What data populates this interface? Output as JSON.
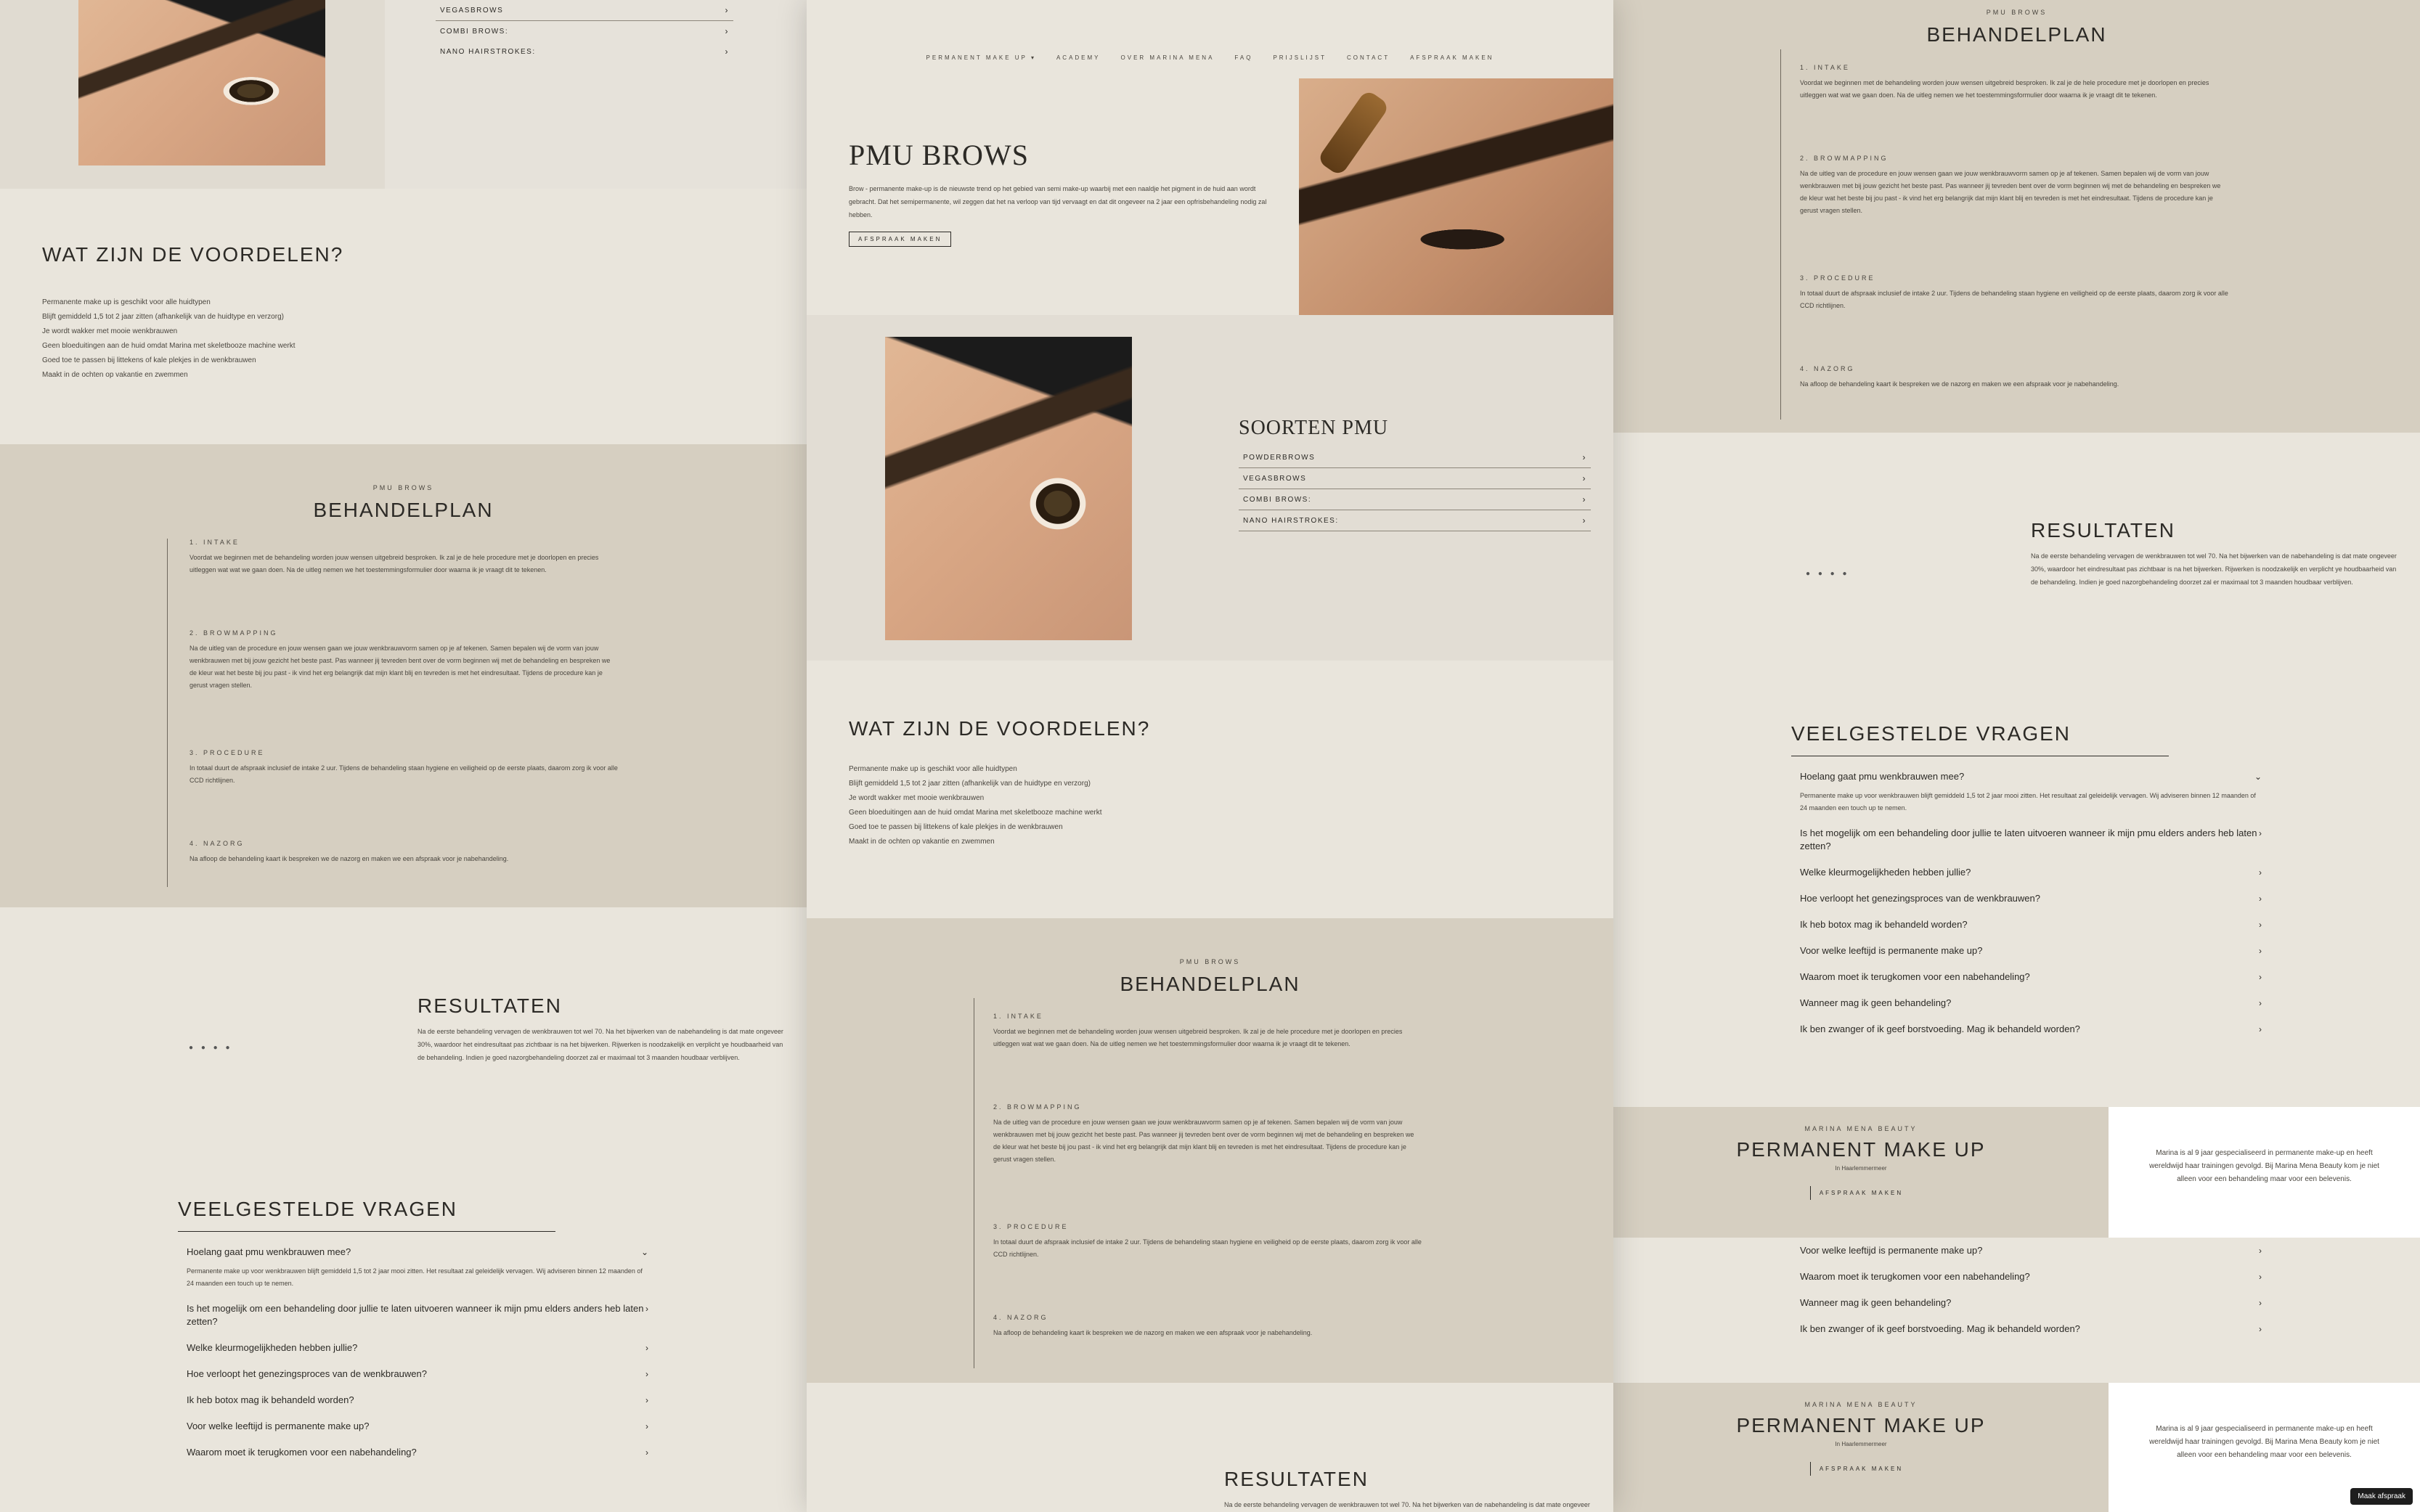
{
  "nav": {
    "items": [
      "PERMANENT MAKE UP ▾",
      "ACADEMY",
      "OVER MARINA MENA",
      "FAQ",
      "PRIJSLIJST",
      "CONTACT",
      "AFSPRAAK MAKEN"
    ]
  },
  "hero": {
    "title": "PMU BROWS",
    "body": "Brow - permanente make-up is de nieuwste trend op het gebied van semi make-up waarbij met een naaldje het pigment in de huid aan wordt gebracht. Dat het semipermanente, wil zeggen dat het na verloop van tijd vervaagt en dat dit ongeveer na 2 jaar een opfrisbehandeling nodig zal hebben.",
    "button": "AFSPRAAK MAKEN"
  },
  "soorten": {
    "title": "SOORTEN PMU",
    "items": [
      "POWDERBROWS",
      "VEGASBROWS",
      "COMBI BROWS:",
      "NANO HAIRSTROKES:"
    ]
  },
  "voordelen": {
    "title": "WAT ZIJN DE VOORDELEN?",
    "items": [
      "Permanente make up is geschikt voor alle huidtypen",
      "Blijft gemiddeld 1,5 tot 2 jaar zitten (afhankelijk van de huidtype en verzorg)",
      "Je wordt wakker met mooie wenkbrauwen",
      "Geen bloeduitingen aan de huid omdat Marina met skeletbooze machine werkt",
      "Goed toe te passen bij littekens of kale plekjes in de wenkbrauwen",
      "Maakt in de ochten op vakantie en zwemmen"
    ]
  },
  "behandelplan": {
    "kicker": "PMU BROWS",
    "title": "BEHANDELPLAN",
    "steps": [
      {
        "title": "1. INTAKE",
        "text": "Voordat we beginnen met de behandeling worden jouw wensen uitgebreid besproken. Ik zal je de hele procedure met je doorlopen en precies uitleggen wat wat we gaan doen. Na de uitleg nemen we het toestemmingsformulier door waarna ik je vraagt dit te tekenen."
      },
      {
        "title": "2. BROWMAPPING",
        "text": "Na de uitleg van de procedure en jouw wensen gaan we jouw wenkbrauwvorm samen op je af tekenen. Samen bepalen wij de vorm van jouw wenkbrauwen met bij jouw gezicht het beste past. Pas wanneer jij tevreden bent over de vorm beginnen wij met de behandeling en bespreken we de kleur wat het beste bij jou past - ik vind het erg belangrijk dat mijn klant blij en tevreden is met het eindresultaat. Tijdens de procedure kan je gerust vragen stellen."
      },
      {
        "title": "3. PROCEDURE",
        "text": "In totaal duurt de afspraak inclusief de intake 2 uur. Tijdens de behandeling staan hygiene en veiligheid op de eerste plaats, daarom zorg ik voor alle CCD richtlijnen."
      },
      {
        "title": "4. NAZORG",
        "text": "Na afloop de behandeling kaart ik bespreken we de nazorg en maken we een afspraak voor je nabehandeling."
      }
    ]
  },
  "resultaten": {
    "title": "RESULTATEN",
    "text": "Na de eerste behandeling vervagen de wenkbrauwen tot wel 70. Na het bijwerken van de nabehandeling is dat mate ongeveer 30%, waardoor het eindresultaat pas zichtbaar is na het bijwerken. Rijwerken is noodzakelijk en verplicht ye houdbaarheid van de behandeling. Indien je goed nazorgbehandeling doorzet zal er maximaal tot 3 maanden houdbaar verblijven.",
    "dots": "● ● ● ●"
  },
  "faq": {
    "title": "VEELGESTELDE VRAGEN",
    "open_question": "Hoelang gaat pmu wenkbrauwen mee?",
    "open_answer": "Permanente make up voor wenkbrauwen blijft gemiddeld 1,5 tot 2 jaar mooi zitten. Het resultaat zal geleidelijk vervagen. Wij adviseren binnen 12 maanden of 24 maanden een touch up te nemen.",
    "questions": [
      "Is het mogelijk om een behandeling door jullie te laten uitvoeren wanneer ik mijn pmu elders anders heb laten zetten?",
      "Welke kleurmogelijkheden hebben jullie?",
      "Hoe verloopt het genezingsproces van de wenkbrauwen?",
      "Ik heb botox mag ik behandeld worden?",
      "Voor welke leeftijd is permanente make up?",
      "Waarom moet ik terugkomen voor een nabehandeling?",
      "Wanneer mag ik geen behandeling?",
      "Ik ben zwanger of ik geef borstvoeding. Mag ik behandeld worden?"
    ]
  },
  "pmu": {
    "kicker": "MARINA MENA BEAUTY",
    "title": "PERMANENT MAKE UP",
    "sub": "In Haarlemmermeer",
    "button": "AFSPRAAK MAKEN",
    "text": "Marina is al 9 jaar gespecialiseerd in permanente make-up en heeft wereldwijd haar trainingen gevolgd. Bij Marina Mena Beauty kom je niet alleen voor een behandeling maar voor een belevenis."
  },
  "badge": "Maak afspraak",
  "chevron": "›",
  "chevron_down": "⌄"
}
